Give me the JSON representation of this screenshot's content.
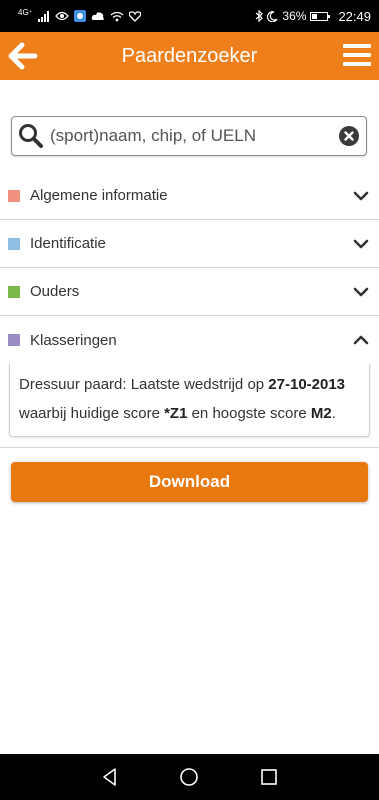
{
  "status_bar": {
    "network": "4G⁺",
    "battery": "36%",
    "battery_level": 0.36,
    "time": "22:49"
  },
  "app_bar": {
    "title": "Paardenzoeker",
    "back_icon": "back-arrow-icon",
    "menu_icon": "hamburger-menu-icon",
    "color": "#ef7f1a"
  },
  "search": {
    "placeholder": "(sport)naam, chip, of UELN",
    "value": ""
  },
  "sections": [
    {
      "label": "Algemene informatie",
      "color": "#f0907e",
      "expanded": false
    },
    {
      "label": "Identificatie",
      "color": "#8fbfe3",
      "expanded": false
    },
    {
      "label": "Ouders",
      "color": "#7bb84a",
      "expanded": false
    },
    {
      "label": "Klasseringen",
      "color": "#9c8cc4",
      "expanded": true
    }
  ],
  "klasseringen": {
    "line1_text": "Dressuur paard: Laatste wedstrijd op ",
    "line1_date": "27-10-2013",
    "line2_text": "waarbij huidige score ",
    "current_score": "*Z1",
    "line2_mid": " en hoogste score ",
    "highest_score": "M2",
    "line2_end": "."
  },
  "download": {
    "label": "Download",
    "color": "#e8790f"
  }
}
